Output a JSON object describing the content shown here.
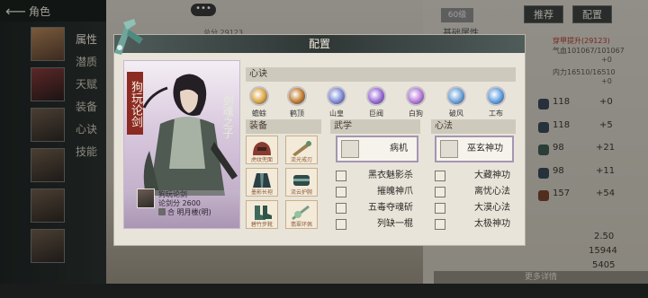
{
  "topbar": {
    "back_icon": "back-arrow-icon",
    "title": "角色"
  },
  "side_menu": [
    "属性",
    "潜质",
    "天赋",
    "装备",
    "心诀",
    "技能"
  ],
  "background": {
    "chat_button": "•••",
    "score_text": "总分 29123",
    "level_tag": "60级",
    "recommend_button": "推荐",
    "configure_button": "配置",
    "basic_attr_label": "基础属性",
    "values": [
      {
        "text": "穿甲提升(29123)",
        "tone": "red"
      },
      {
        "text": "气血101067/101067",
        "tone": "normal"
      },
      {
        "text": "+0",
        "tone": "normal"
      },
      {
        "text": "内力16510/16510",
        "tone": "normal"
      },
      {
        "text": "+0",
        "tone": "normal"
      }
    ],
    "stats": [
      {
        "value": "118",
        "bonus": "+0"
      },
      {
        "value": "118",
        "bonus": "+5"
      },
      {
        "value": "98",
        "bonus": "+21"
      },
      {
        "value": "98",
        "bonus": "+11"
      },
      {
        "value": "157",
        "bonus": "+54"
      }
    ],
    "bottom_values": [
      "2.50",
      "15944",
      "5405"
    ],
    "more_details": "更多详情"
  },
  "dialog": {
    "title": "配置",
    "card": {
      "title": "狗玩论剑",
      "subtitle": "剑魂之子",
      "name_line": "狗玩论剑",
      "sword_score": "论剑分 2600",
      "faction_line": "合 明月楼(明)"
    },
    "xinjue": {
      "header": "心诀",
      "items": [
        {
          "label": "蟾蜍",
          "color": "#d9a441"
        },
        {
          "label": "鹤顶",
          "color": "#c07a2c"
        },
        {
          "label": "山皇",
          "color": "#7d8ad6"
        },
        {
          "label": "巨阀",
          "color": "#9b6ad8"
        },
        {
          "label": "白狗",
          "color": "#b779d9"
        },
        {
          "label": "破风",
          "color": "#6aa2d9"
        },
        {
          "label": "工布",
          "color": "#5e9fe0"
        }
      ]
    },
    "equipment": {
      "header": "装备",
      "items": [
        {
          "name": "虎纹兜面",
          "icon": "helmet-icon"
        },
        {
          "name": "流光戒刃",
          "icon": "ring-icon"
        },
        {
          "name": "墨影长袍",
          "icon": "robe-icon"
        },
        {
          "name": "流云护腕",
          "icon": "bracer-icon"
        },
        {
          "name": "碧竹步靴",
          "icon": "boots-icon"
        },
        {
          "name": "翡翠环佩",
          "icon": "pendant-icon"
        }
      ]
    },
    "martial": {
      "header": "武学",
      "main": "病机",
      "items": [
        "黑衣魅影杀",
        "摧魄神爪",
        "五毒夺魂斫",
        "列缺一棍"
      ]
    },
    "mind": {
      "header": "心法",
      "main": "巫玄神功",
      "items": [
        "大藏神功",
        "离忧心法",
        "大漠心法",
        "太极神功"
      ]
    }
  }
}
